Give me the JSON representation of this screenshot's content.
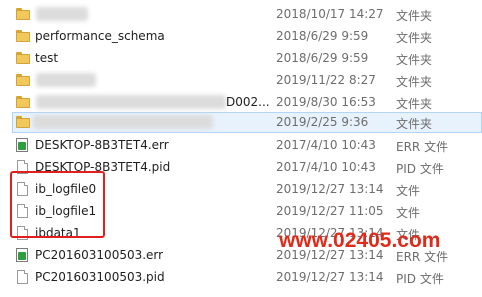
{
  "rows": [
    {
      "name": "",
      "date": "2018/10/17 14:27",
      "type": "文件夹",
      "icon": "folder-icon",
      "blurred": true
    },
    {
      "name": "performance_schema",
      "date": "2018/6/29 9:59",
      "type": "文件夹",
      "icon": "folder-icon"
    },
    {
      "name": "test",
      "date": "2018/6/29 9:59",
      "type": "文件夹",
      "icon": "folder-icon"
    },
    {
      "name": "",
      "date": "2019/11/22 8:27",
      "type": "文件夹",
      "icon": "folder-icon",
      "blurred": true
    },
    {
      "name": "D002...",
      "date": "2019/8/30 16:53",
      "type": "文件夹",
      "icon": "folder-icon",
      "blurred": true
    },
    {
      "name": "",
      "date": "2019/2/25 9:36",
      "type": "文件夹",
      "icon": "folder-icon",
      "blurred": true,
      "selected": true
    },
    {
      "name": "DESKTOP-8B3TET4.err",
      "date": "2017/4/10 10:43",
      "type": "ERR 文件",
      "icon": "err-file-icon"
    },
    {
      "name": "DESKTOP-8B3TET4.pid",
      "date": "2017/4/10 10:43",
      "type": "PID 文件",
      "icon": "file-icon"
    },
    {
      "name": "ib_logfile0",
      "date": "2019/12/27 13:14",
      "type": "文件",
      "icon": "file-icon"
    },
    {
      "name": "ib_logfile1",
      "date": "2019/12/27 11:05",
      "type": "文件",
      "icon": "file-icon"
    },
    {
      "name": "ibdata1",
      "date": "2019/12/27 13:14",
      "type": "文件",
      "icon": "file-icon"
    },
    {
      "name": "PC201603100503.err",
      "date": "2019/12/27 13:14",
      "type": "ERR 文件",
      "icon": "err-file-icon"
    },
    {
      "name": "PC201603100503.pid",
      "date": "2019/12/27 13:14",
      "type": "PID 文件",
      "icon": "file-icon"
    }
  ],
  "watermark": "www.02405.com",
  "colors": {
    "highlight_box": "#e0201c",
    "watermark": "#e02a1a",
    "selected_row": "#e8f2fd"
  }
}
